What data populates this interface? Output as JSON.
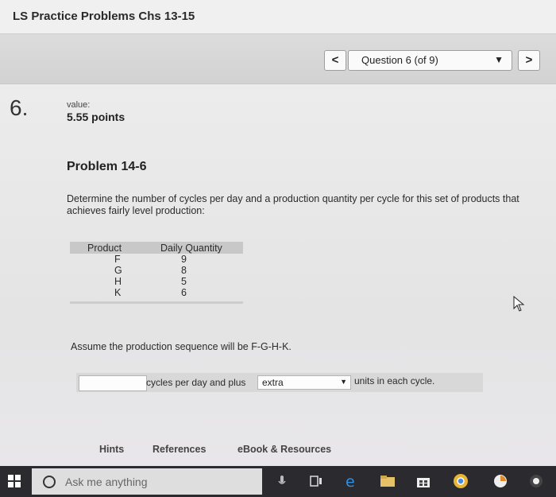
{
  "header": {
    "title": "LS Practice Problems Chs 13-15"
  },
  "nav": {
    "prev": "<",
    "question_label": "Question 6 (of 9)",
    "next": ">"
  },
  "question": {
    "number": "6.",
    "value_label": "value:",
    "points": "5.55 points",
    "problem_title": "Problem 14-6",
    "description": "Determine the number of cycles per day and a production quantity per cycle for this set of products that achieves fairly level production:",
    "table": {
      "headers": [
        "Product",
        "Daily Quantity"
      ],
      "rows": [
        [
          "F",
          "9"
        ],
        [
          "G",
          "8"
        ],
        [
          "H",
          "5"
        ],
        [
          "K",
          "6"
        ]
      ]
    },
    "assumption": "Assume the production sequence will be F-G-H-K.",
    "answer": {
      "input_value": "",
      "cycles_text": "cycles per day and plus",
      "dropdown_value": "extra",
      "units_text": "units in each cycle."
    }
  },
  "tabs": [
    "Hints",
    "References",
    "eBook & Resources"
  ],
  "taskbar": {
    "search_placeholder": "Ask me anything"
  }
}
